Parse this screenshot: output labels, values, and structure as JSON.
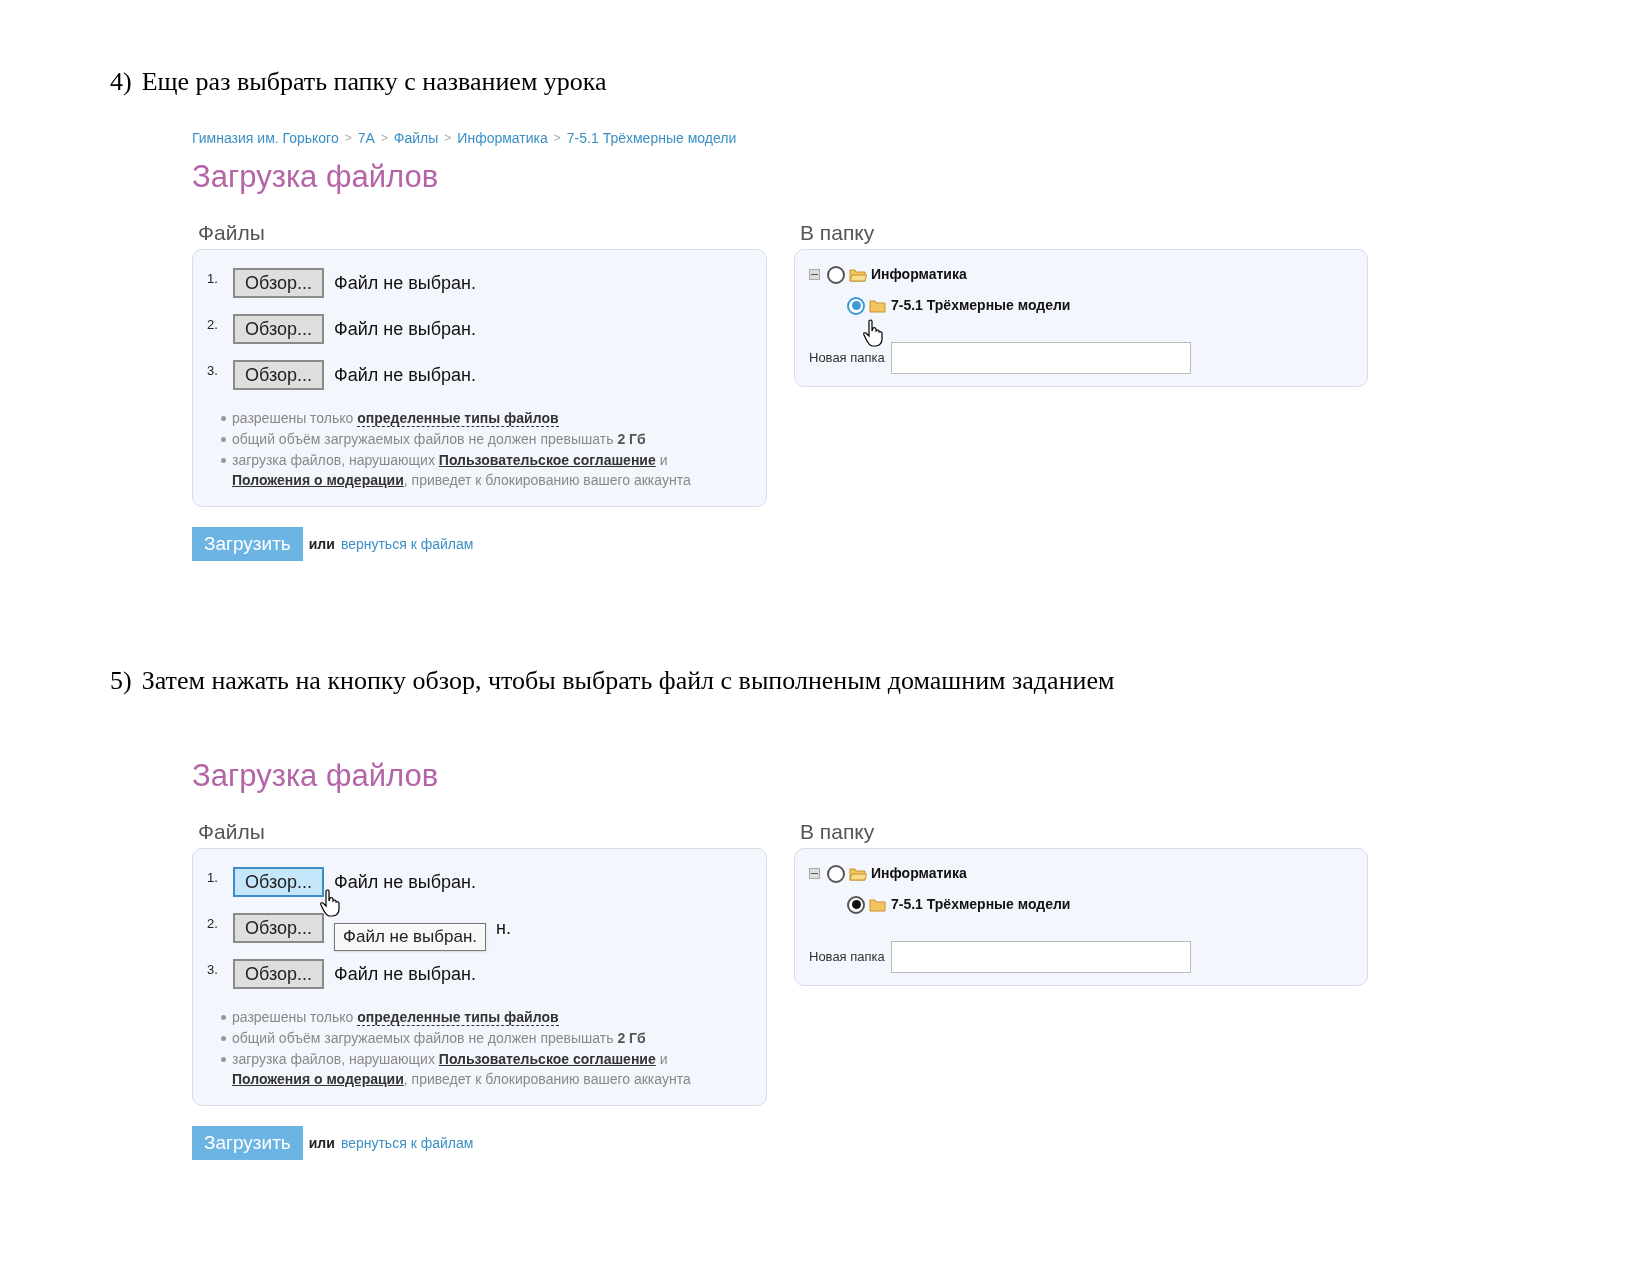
{
  "steps": [
    {
      "number": "4)",
      "text": "Еще раз выбрать папку с названием урока",
      "screen": {
        "breadcrumb": [
          "Гимназия им. Горького",
          "7А",
          "Файлы",
          "Информатика",
          "7-5.1 Трёхмерные модели"
        ],
        "breadcrumb_separator": ">",
        "title": "Загрузка файлов",
        "files_heading": "Файлы",
        "file_rows": [
          {
            "number": "1.",
            "button": "Обзор...",
            "hovered": false,
            "status": "Файл не выбран."
          },
          {
            "number": "2.",
            "button": "Обзор...",
            "hovered": false,
            "status": "Файл не выбран."
          },
          {
            "number": "3.",
            "button": "Обзор...",
            "hovered": false,
            "status": "Файл не выбран."
          }
        ],
        "rules": [
          [
            {
              "kind": "plain",
              "text": "разрешены только "
            },
            {
              "kind": "dotted-link",
              "text": "определенные типы файлов"
            }
          ],
          [
            {
              "kind": "plain",
              "text": "общий объём загружаемых файлов не должен превышать "
            },
            {
              "kind": "bold",
              "text": "2 Гб"
            }
          ],
          [
            {
              "kind": "plain",
              "text": "загрузка файлов, нарушающих "
            },
            {
              "kind": "link",
              "text": "Пользовательское соглашение"
            },
            {
              "kind": "plain",
              "text": " и "
            },
            {
              "kind": "link",
              "text": "Положения о модерации"
            },
            {
              "kind": "plain",
              "text": ", приведет к блокированию вашего аккаунта"
            }
          ]
        ],
        "folder_heading": "В папку",
        "tree": [
          {
            "label": "Информатика",
            "expanded": true,
            "selected": false,
            "focused": false,
            "children": [
              {
                "label": "7-5.1 Трёхмерные модели",
                "selected": true,
                "focused": true
              }
            ]
          }
        ],
        "new_folder_label": "Новая папка",
        "upload_button": "Загрузить",
        "or_text": "или",
        "back_link": "вернуться к файлам"
      }
    },
    {
      "number": "5)",
      "text": "Затем нажать на кнопку обзор, чтобы выбрать файл с выполненым домашним заданием",
      "screen": {
        "title": "Загрузка файлов",
        "files_heading": "Файлы",
        "file_rows": [
          {
            "number": "1.",
            "button": "Обзор...",
            "hovered": true,
            "status": "Файл не выбран."
          },
          {
            "number": "2.",
            "button": "Обзор...",
            "hovered": false,
            "tooltip": "Файл не выбран.",
            "status": "н."
          },
          {
            "number": "3.",
            "button": "Обзор...",
            "hovered": false,
            "status": "Файл не выбран."
          }
        ],
        "rules": [
          [
            {
              "kind": "plain",
              "text": "разрешены только "
            },
            {
              "kind": "dotted-link",
              "text": "определенные типы файлов"
            }
          ],
          [
            {
              "kind": "plain",
              "text": "общий объём загружаемых файлов не должен превышать "
            },
            {
              "kind": "bold",
              "text": "2 Гб"
            }
          ],
          [
            {
              "kind": "plain",
              "text": "загрузка файлов, нарушающих "
            },
            {
              "kind": "link",
              "text": "Пользовательское соглашение"
            },
            {
              "kind": "plain",
              "text": " и "
            },
            {
              "kind": "link",
              "text": "Положения о модерации"
            },
            {
              "kind": "plain",
              "text": ", приведет к блокированию вашего аккаунта"
            }
          ]
        ],
        "folder_heading": "В папку",
        "tree": [
          {
            "label": "Информатика",
            "expanded": true,
            "selected": false,
            "focused": false,
            "children": [
              {
                "label": "7-5.1 Трёхмерные модели",
                "selected": true,
                "focused": false
              }
            ]
          }
        ],
        "new_folder_label": "Новая папка",
        "upload_button": "Загрузить",
        "or_text": "или",
        "back_link": "вернуться к файлам"
      }
    }
  ]
}
